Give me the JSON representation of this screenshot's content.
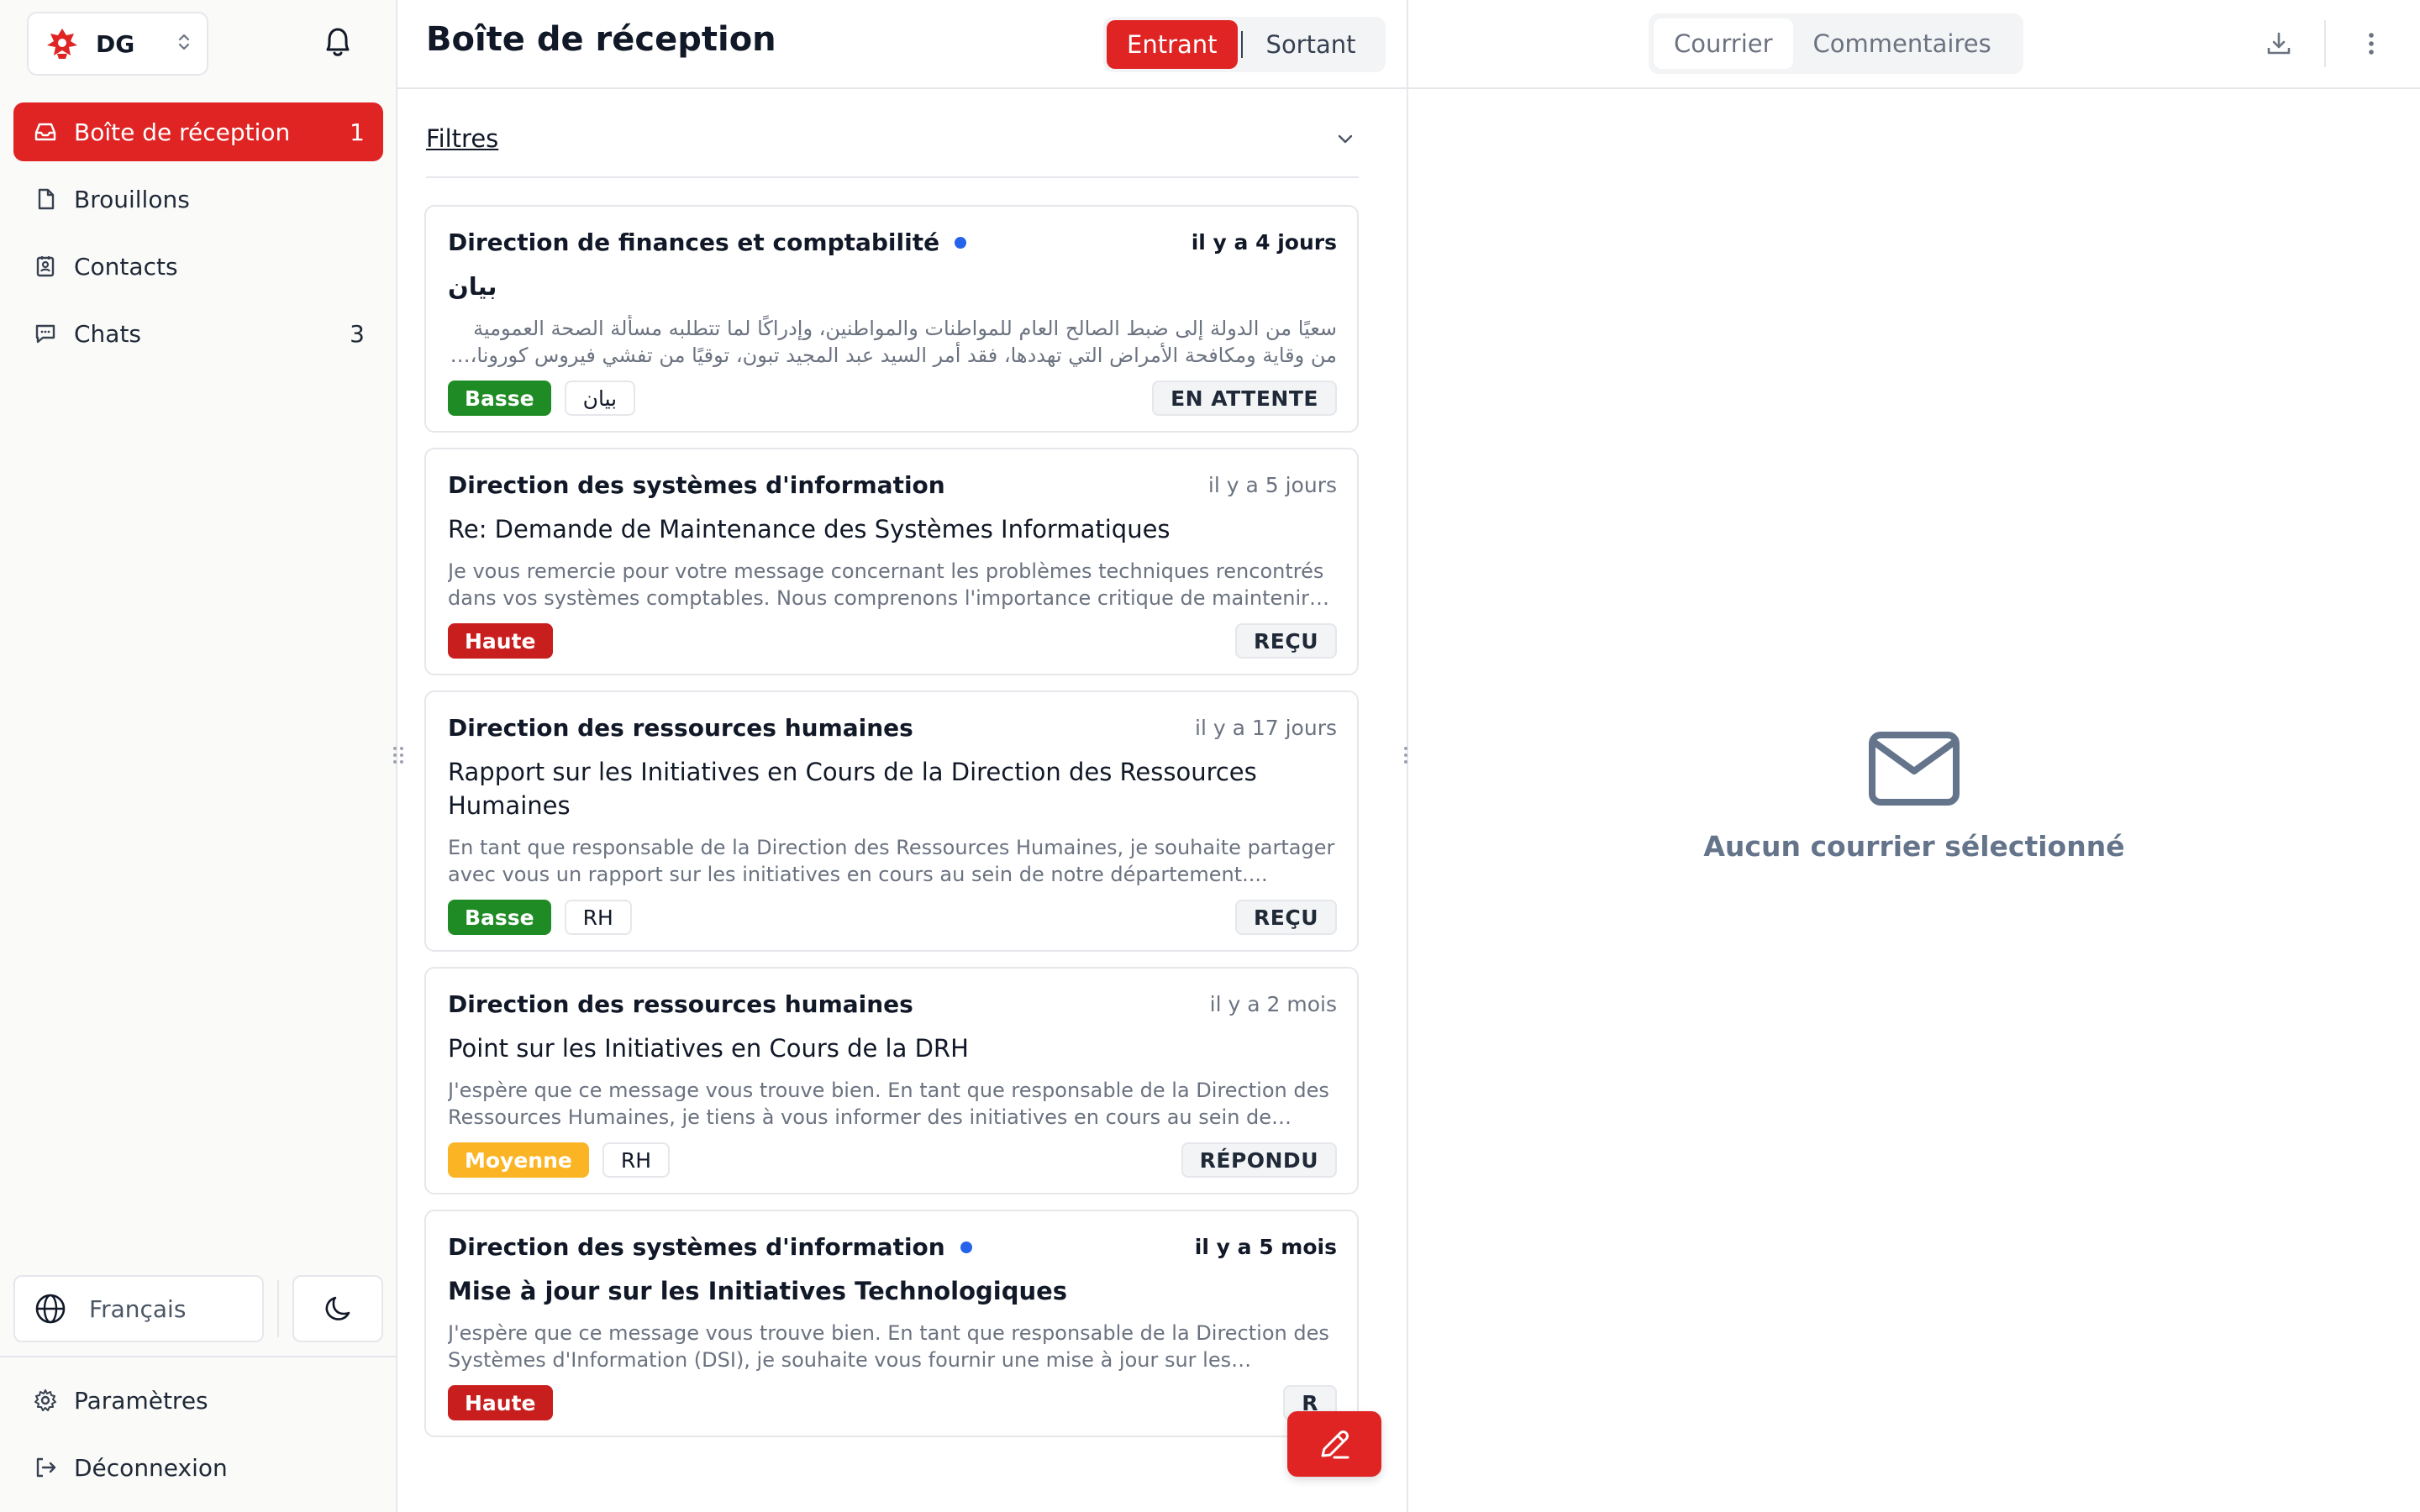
{
  "org": {
    "name": "DG"
  },
  "sidebar": {
    "items": [
      {
        "label": "Boîte de réception",
        "count": "1"
      },
      {
        "label": "Brouillons",
        "count": ""
      },
      {
        "label": "Contacts",
        "count": ""
      },
      {
        "label": "Chats",
        "count": "3"
      }
    ],
    "language": "Français",
    "bottom_items": [
      {
        "label": "Paramètres"
      },
      {
        "label": "Déconnexion"
      }
    ]
  },
  "inbox": {
    "title": "Boîte de réception",
    "direction": {
      "incoming": "Entrant",
      "outgoing": "Sortant",
      "selected": "Entrant"
    },
    "filters_label": "Filtres",
    "mails": [
      {
        "sender": "Direction de finances et comptabilité",
        "unread": true,
        "time": "il y a 4 jours",
        "subject": "بيان",
        "preview": "سعيًا من الدولة إلى ضبط الصالح العام للمواطنات والمواطنين، وإدراكًا لما تتطلبه مسألة الصحة العمومية من وقاية ومكافحة الأمراض التي تهددها، فقد أمر السيد عبد المجيد تبون، توقيًا من تفشي فيروس كورونا، باتخاذ الإجراءات الوقائية والاحترازية في",
        "rtl": true,
        "priority": "Basse",
        "priority_level": "basse",
        "category": "بيان",
        "status": "EN ATTENTE"
      },
      {
        "sender": "Direction des systèmes d'information",
        "unread": false,
        "time": "il y a 5 jours",
        "subject": "Re: Demande de Maintenance des Systèmes Informatiques",
        "preview": "Je vous remercie pour votre message concernant les problèmes techniques rencontrés dans vos systèmes comptables. Nous comprenons l'importance critique de maintenir la...",
        "rtl": false,
        "priority": "Haute",
        "priority_level": "haute",
        "category": "",
        "status": "REÇU"
      },
      {
        "sender": "Direction des ressources humaines",
        "unread": false,
        "time": "il y a 17 jours",
        "subject": "Rapport sur les Initiatives en Cours de la Direction des Ressources Humaines",
        "preview": "En tant que responsable de la Direction des Ressources Humaines, je souhaite partager avec vous un rapport sur les initiatives en cours au sein de notre département....",
        "rtl": false,
        "priority": "Basse",
        "priority_level": "basse",
        "category": "RH",
        "status": "REÇU"
      },
      {
        "sender": "Direction des ressources humaines",
        "unread": false,
        "time": "il y a 2 mois",
        "subject": "Point sur les Initiatives en Cours de la DRH",
        "preview": "J'espère que ce message vous trouve bien. En tant que responsable de la Direction des Ressources Humaines, je tiens à vous informer des initiatives en cours au sein de notre...",
        "rtl": false,
        "priority": "Moyenne",
        "priority_level": "moyenne",
        "category": "RH",
        "status": "RÉPONDU"
      },
      {
        "sender": "Direction des systèmes d'information",
        "unread": true,
        "time": "il y a 5 mois",
        "subject": "Mise à jour sur les Initiatives Technologiques",
        "preview": "J'espère que ce message vous trouve bien. En tant que responsable de la Direction des Systèmes d'Information (DSI), je souhaite vous fournir une mise à jour sur les initiatives...",
        "rtl": false,
        "priority": "Haute",
        "priority_level": "haute",
        "category": "",
        "status": "R"
      }
    ]
  },
  "detail": {
    "tabs": {
      "mail": "Courrier",
      "comments": "Commentaires"
    },
    "empty_text": "Aucun courrier sélectionné"
  },
  "icons": {
    "org_logo": "eagle-emblem-icon",
    "bell": "bell-icon",
    "inbox": "inbox-icon",
    "drafts": "document-icon",
    "contacts": "contact-card-icon",
    "chats": "chat-bubble-icon",
    "language": "globe-icon",
    "theme": "moon-icon",
    "settings": "gear-icon",
    "logout": "logout-icon",
    "download": "download-icon",
    "more": "more-vertical-icon",
    "empty": "envelope-icon",
    "compose": "pencil-icon"
  },
  "colors": {
    "accent": "#e02424",
    "priority_low": "#1f8b24",
    "priority_high": "#c81e1e",
    "priority_medium": "#fbb424",
    "unread_dot": "#2563eb"
  }
}
